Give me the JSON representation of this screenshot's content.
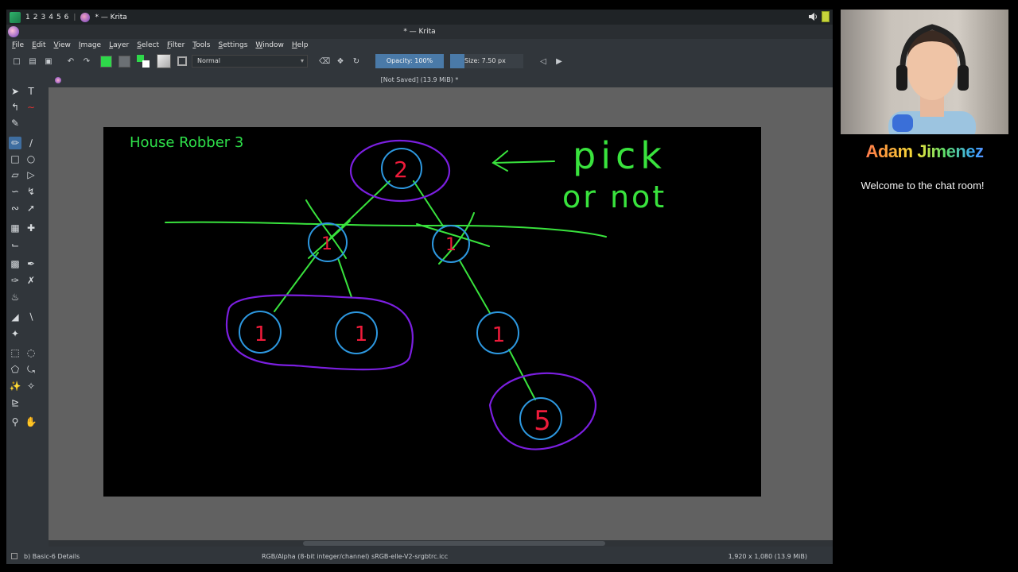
{
  "taskbar": {
    "workspaces": [
      "1",
      "2",
      "3",
      "4",
      "5",
      "6"
    ],
    "window_title": "* — Krita"
  },
  "titlebar": {
    "title": "* — Krita"
  },
  "menu": [
    "File",
    "Edit",
    "View",
    "Image",
    "Layer",
    "Select",
    "Filter",
    "Tools",
    "Settings",
    "Window",
    "Help"
  ],
  "tool_options": {
    "blend_mode": "Normal",
    "opacity": "Opacity: 100%",
    "size": "Size: 7.50 px",
    "foreground_color": "#2ed84a",
    "background_color": "#6b7074"
  },
  "document_tab": {
    "label": "[Not Saved]  (13.9 MiB) *"
  },
  "canvas": {
    "title": "House Robber 3",
    "annotation_line1": "pick",
    "annotation_line2": "or not",
    "nodes": [
      "2",
      "1",
      "1",
      "1",
      "1",
      "1",
      "5"
    ]
  },
  "statusbar": {
    "brush": "b) Basic-6 Details",
    "color_profile": "RGB/Alpha (8-bit integer/channel)  sRGB-elle-V2-srgbtrc.icc",
    "dimensions": "1,920 x 1,080 (13.9 MiB)"
  },
  "stream": {
    "streamer_name": "Adam Jimenez",
    "chat_message": "Welcome to the chat room!"
  }
}
